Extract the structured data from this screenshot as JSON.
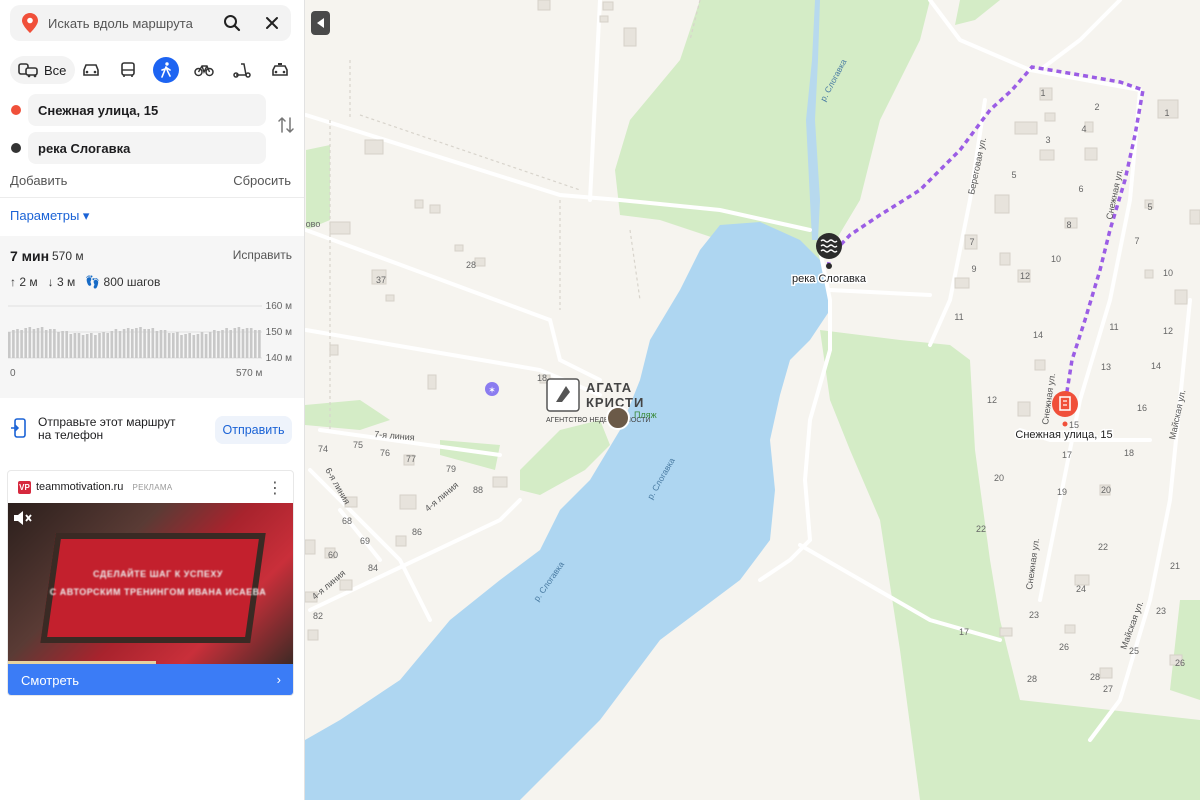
{
  "search": {
    "placeholder": "Искать вдоль маршрута"
  },
  "modes": {
    "all_label": "Все"
  },
  "route": {
    "from": "Снежная улица, 15",
    "to": "река Слогавка",
    "add_label": "Добавить",
    "reset_label": "Сбросить",
    "params_label": "Параметры ▾",
    "time": "7 мин",
    "distance": "570 м",
    "fix_label": "Исправить",
    "ascent": "2 м",
    "descent": "3 м",
    "steps": "800 шагов",
    "elevation": {
      "y_labels": [
        "160 м",
        "150 м",
        "140 м"
      ],
      "x_start": "0",
      "x_end": "570 м"
    }
  },
  "send": {
    "text": "Отправьте этот маршрут на телефон",
    "button": "Отправить"
  },
  "ad": {
    "site": "teammotivation.ru",
    "tag": "РЕКЛАМА",
    "image_text_1": "СДЕЛАЙТЕ ШАГ К УСПЕХУ",
    "image_text_2": "С АВТОРСКИМ ТРЕНИНГОМ ИВАНА ИСАЕВА",
    "progress": 0.52,
    "watch_label": "Смотреть"
  },
  "map": {
    "destination_label": "река Слогавка",
    "start_label": "Снежная улица, 15",
    "watermark_1": "АГАТА",
    "watermark_2": "КРИСТИ",
    "watermark_3": "АГЕНТСТВО НЕДВИЖИМОСТИ",
    "beach_label": "Пляж",
    "river_labels": [
      "р. Слогавка",
      "р. Слогавка",
      "р. Слогавка"
    ],
    "streets": [
      "Береговая ул.",
      "Снежная ул.",
      "Снежная ул.",
      "Майская ул.",
      "Майская ул.",
      "7-я линия",
      "6-я линия",
      "4-я линия",
      "4-я линия",
      "Снежная ул."
    ],
    "house_numbers": [
      "1",
      "2",
      "3",
      "4",
      "5",
      "6",
      "7",
      "8",
      "9",
      "10",
      "11",
      "12",
      "13",
      "14",
      "15",
      "16",
      "17",
      "18",
      "19",
      "20",
      "21",
      "22",
      "23",
      "24",
      "25",
      "26",
      "27",
      "28",
      "5",
      "7",
      "1",
      "10",
      "12",
      "11",
      "14",
      "12",
      "20",
      "22",
      "23",
      "17",
      "26",
      "28",
      "74",
      "75",
      "76",
      "77",
      "79",
      "88",
      "86",
      "68",
      "69",
      "60",
      "84",
      "82",
      "28",
      "37",
      "18",
      "ово"
    ],
    "colors": {
      "water": "#aed6f1",
      "forest": "#d4ecc6",
      "route": "#9b5de5",
      "start_marker": "#f0503a",
      "dest_marker": "#2b2b2b"
    }
  }
}
